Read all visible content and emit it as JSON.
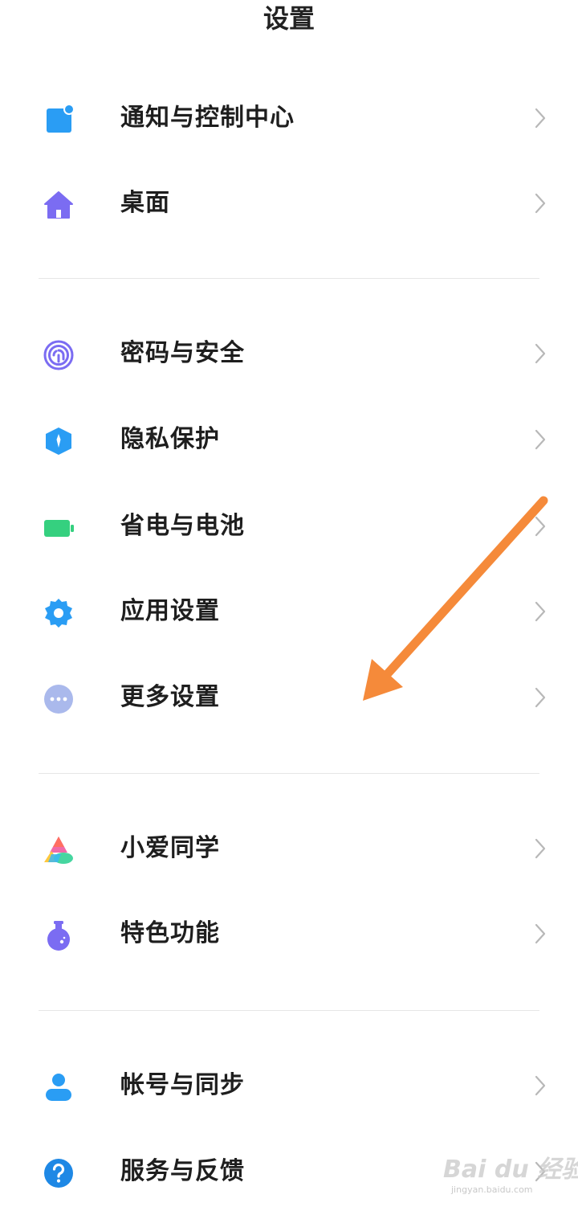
{
  "header": {
    "title": "设置"
  },
  "groups": [
    {
      "items": [
        {
          "label": "通知与控制中心",
          "icon": "notification-icon"
        },
        {
          "label": "桌面",
          "icon": "home-icon"
        }
      ]
    },
    {
      "items": [
        {
          "label": "密码与安全",
          "icon": "fingerprint-icon"
        },
        {
          "label": "隐私保护",
          "icon": "privacy-shield-icon"
        },
        {
          "label": "省电与电池",
          "icon": "battery-icon"
        },
        {
          "label": "应用设置",
          "icon": "app-gear-icon"
        },
        {
          "label": "更多设置",
          "icon": "more-icon"
        }
      ]
    },
    {
      "items": [
        {
          "label": "小爱同学",
          "icon": "xiaoai-assistant-icon"
        },
        {
          "label": "特色功能",
          "icon": "flask-icon"
        }
      ]
    },
    {
      "items": [
        {
          "label": "帐号与同步",
          "icon": "account-icon"
        },
        {
          "label": "服务与反馈",
          "icon": "help-icon"
        }
      ]
    }
  ],
  "annotation": {
    "arrow_color": "#f58a3a"
  },
  "watermark": {
    "main": "Bai du 经验",
    "sub": "jingyan.baidu.com"
  },
  "colors": {
    "notification": "#2a9df4",
    "home": "#7b6cf2",
    "fingerprint": "#7b6cf2",
    "privacy": "#2a9df4",
    "battery": "#35d07f",
    "app_settings": "#2a9df4",
    "more": "#aab9ec",
    "flask": "#7b6cf2",
    "account": "#2a9df4",
    "help": "#1e88e5",
    "chevron": "#b8b8b8"
  }
}
